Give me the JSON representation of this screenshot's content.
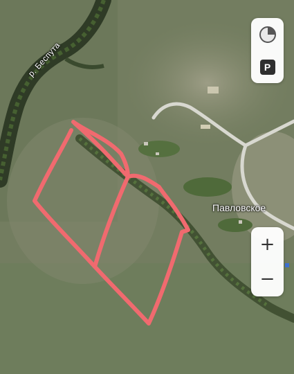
{
  "map": {
    "river_label": "р. Беспута",
    "village_label": "Павловское"
  },
  "controls": {
    "zoom_in_label": "+",
    "zoom_out_label": "−",
    "parking_label": "P",
    "traffic_icon": "traffic-icon",
    "parking_icon": "parking-icon"
  },
  "colors": {
    "plot_outline": "#f06a6f",
    "river": "#2f3b26",
    "road": "#d8d8d0"
  }
}
